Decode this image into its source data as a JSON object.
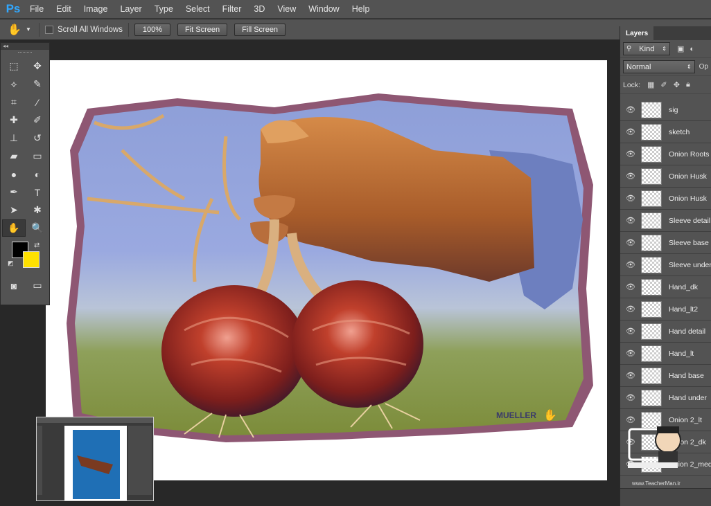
{
  "app": {
    "logo": "Ps"
  },
  "menu": [
    "File",
    "Edit",
    "Image",
    "Layer",
    "Type",
    "Select",
    "Filter",
    "3D",
    "View",
    "Window",
    "Help"
  ],
  "options": {
    "tool_icon": "hand-icon",
    "scroll_all_windows": "Scroll All Windows",
    "zoom_100": "100%",
    "fit_screen": "Fit Screen",
    "fill_screen": "Fill Screen"
  },
  "toolbox": {
    "collapse": "◂◂",
    "tools": [
      {
        "name": "marquee-icon",
        "glyph": "⬚"
      },
      {
        "name": "move-icon",
        "glyph": "✥"
      },
      {
        "name": "lasso-icon",
        "glyph": "⟡"
      },
      {
        "name": "quick-select-icon",
        "glyph": "✎"
      },
      {
        "name": "crop-icon",
        "glyph": "⌗"
      },
      {
        "name": "eyedropper-icon",
        "glyph": "⁄"
      },
      {
        "name": "healing-icon",
        "glyph": "✚"
      },
      {
        "name": "brush-icon",
        "glyph": "✐"
      },
      {
        "name": "stamp-icon",
        "glyph": "⊥"
      },
      {
        "name": "history-brush-icon",
        "glyph": "↺"
      },
      {
        "name": "eraser-icon",
        "glyph": "▰"
      },
      {
        "name": "gradient-icon",
        "glyph": "▭"
      },
      {
        "name": "blur-icon",
        "glyph": "●"
      },
      {
        "name": "dodge-icon",
        "glyph": "◐"
      },
      {
        "name": "pen-icon",
        "glyph": "✒"
      },
      {
        "name": "type-icon",
        "glyph": "T"
      },
      {
        "name": "path-select-icon",
        "glyph": "➤"
      },
      {
        "name": "shape-icon",
        "glyph": "✱"
      },
      {
        "name": "hand-icon",
        "glyph": "✋"
      },
      {
        "name": "zoom-icon",
        "glyph": "🔍"
      }
    ],
    "fg_color": "#000000",
    "bg_color": "#ffe100"
  },
  "layers_panel": {
    "tab": "Layers",
    "filter_kind": "Kind",
    "blend_mode": "Normal",
    "opacity_label": "Op",
    "lock_label": "Lock:",
    "layers": [
      "sig",
      "sketch",
      "Onion Roots",
      "Onion Husk",
      "Onion Husk",
      "Sleeve detail",
      "Sleeve base",
      "Sleeve under",
      "Hand_dk",
      "Hand_lt2",
      "Hand detail",
      "Hand_lt",
      "Hand base",
      "Hand under",
      "Onion 2_lt",
      "Onion 2_dk",
      "Onion 2_med"
    ]
  },
  "artwork": {
    "signature": "MUELLER"
  },
  "watermark": {
    "url": "www.TeacherMan.ir",
    "name": "TeacherMan"
  },
  "colors": {
    "accent": "#31a8ff",
    "panel": "#535353",
    "workspace": "#282828"
  }
}
